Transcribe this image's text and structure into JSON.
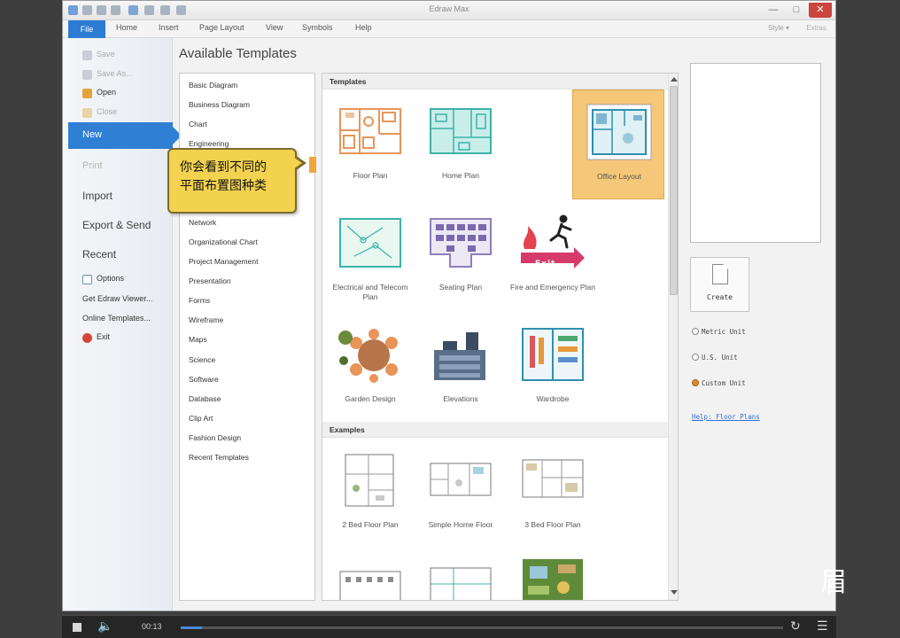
{
  "window": {
    "title": "Edraw Max",
    "minimize_glyph": "—",
    "maximize_glyph": "□",
    "close_glyph": "✕"
  },
  "ribbon": {
    "tabs": [
      "File",
      "Home",
      "Insert",
      "Page Layout",
      "View",
      "Symbols",
      "Help"
    ],
    "style_label": "Style ▾",
    "extra_label": "Extras"
  },
  "backstage": {
    "save": "Save",
    "save_as": "Save As...",
    "open": "Open",
    "close": "Close",
    "new": "New",
    "print": "Print",
    "import": "Import",
    "export_send": "Export & Send",
    "recent": "Recent",
    "options": "Options",
    "get_viewer": "Get Edraw Viewer...",
    "online_templates": "Online Templates...",
    "exit": "Exit"
  },
  "main": {
    "title": "Available Templates"
  },
  "categories": [
    "Basic Diagram",
    "Business Diagram",
    "Chart",
    "Engineering",
    "Network",
    "Organizational Chart",
    "Project Management",
    "Presentation",
    "Forms",
    "Wireframe",
    "Maps",
    "Science",
    "Software",
    "Database",
    "Clip Art",
    "Fashion Design",
    "Recent Templates"
  ],
  "tooltip": {
    "line1": "你会看到不同的",
    "line2": "平面布置图种类"
  },
  "templates": {
    "section_label": "Templates",
    "items": [
      {
        "label": "Floor Plan"
      },
      {
        "label": "Home Plan"
      },
      {
        "label": "Office Layout"
      },
      {
        "label": "Electrical and Telecom Plan"
      },
      {
        "label": "Seating Plan"
      },
      {
        "label": "Fire and Emergency Plan"
      },
      {
        "label": "Garden Design"
      },
      {
        "label": "Elevations"
      },
      {
        "label": "Wardrobe"
      }
    ],
    "selected": "Office Layout",
    "exit_sign_text": "Exit"
  },
  "examples": {
    "section_label": "Examples",
    "items": [
      {
        "label": "2 Bed Floor Plan"
      },
      {
        "label": "Simple Home Floor"
      },
      {
        "label": "3 Bed Floor Plan"
      }
    ]
  },
  "right_panel": {
    "create_label": "Create",
    "units": [
      {
        "label": "Metric Unit",
        "selected": false
      },
      {
        "label": "U.S. Unit",
        "selected": false
      },
      {
        "label": "Custom Unit",
        "selected": true
      }
    ],
    "help_link": "Help: Floor Plans"
  },
  "player": {
    "time": "00:13",
    "progress_fraction": 0.035,
    "stop_icon": "stop-icon",
    "volume_glyph": "🔈",
    "replay_glyph": "↻",
    "playlist_glyph": "☰"
  },
  "overlay_glyph": "眉",
  "colors": {
    "accent_blue": "#2f7fd4",
    "selection_orange": "#f5c778",
    "tooltip_yellow": "#f3d24f",
    "plan_orange": "#e8955a",
    "plan_teal": "#3bb3a8"
  }
}
